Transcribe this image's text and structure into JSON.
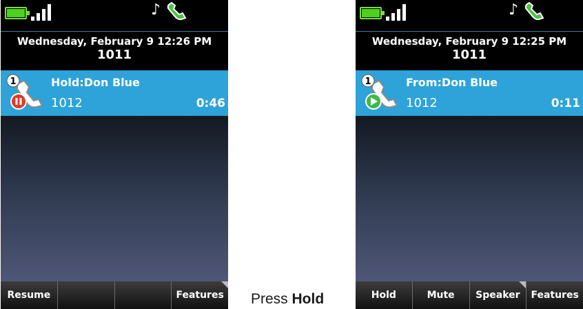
{
  "left_phone": {
    "date": "Wednesday, February 9 12:26 PM",
    "line": "1011",
    "call": {
      "badge": "1",
      "title": "Hold:Don Blue",
      "number": "1012",
      "timer": "0:46",
      "state": "hold"
    },
    "softkeys": [
      "Resume",
      "",
      "",
      "Features"
    ]
  },
  "right_phone": {
    "date": "Wednesday, February 9 12:25 PM",
    "line": "1011",
    "call": {
      "badge": "1",
      "title": "From:Don Blue",
      "number": "1012",
      "timer": "0:11",
      "state": "active"
    },
    "softkeys": [
      "Hold",
      "Mute",
      "Speaker",
      "Features"
    ]
  },
  "caption": {
    "prefix": "Press ",
    "action": "Hold"
  },
  "icons": {
    "battery": "battery-icon",
    "signal": "signal-strength-icon",
    "ringer": "music-note-icon",
    "line_status": "handset-icon",
    "hold": "hold-call-icon",
    "active": "active-call-icon"
  },
  "colors": {
    "call_highlight": "#2ea3d9",
    "battery": "#4fd21e",
    "hold_indicator": "#e03a2a",
    "active_indicator": "#3fb84a",
    "softkey_bar": "#2a2a2a"
  }
}
